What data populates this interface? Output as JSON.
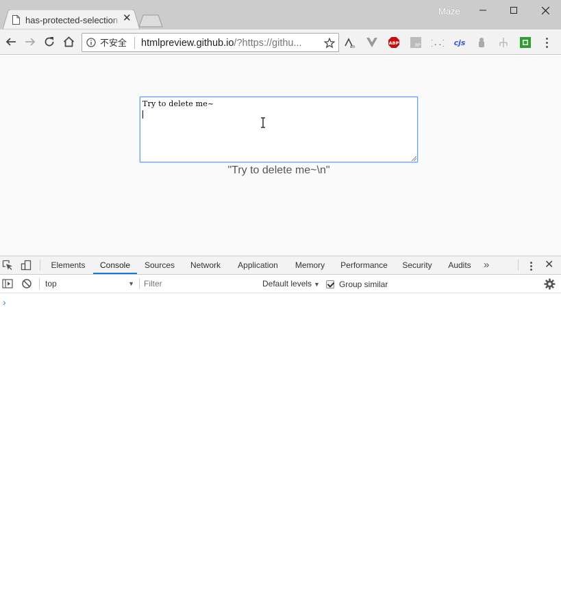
{
  "browser": {
    "tab_title": "has-protected-selection",
    "profile_name": "Maze",
    "security_label": "不安全",
    "url_host": "htmlpreview.github.io",
    "url_rest": "/?https://githu..."
  },
  "page": {
    "textarea_text": "Try to delete me~",
    "output_text": "\"Try to delete me~\\n\""
  },
  "devtools": {
    "tabs": [
      {
        "label": "Elements"
      },
      {
        "label": "Console"
      },
      {
        "label": "Sources"
      },
      {
        "label": "Network"
      },
      {
        "label": "Application"
      },
      {
        "label": "Memory"
      },
      {
        "label": "Performance"
      },
      {
        "label": "Security"
      },
      {
        "label": "Audits"
      }
    ],
    "active_tab": "Console",
    "context": "top",
    "filter_placeholder": "Filter",
    "levels_label": "Default levels",
    "group_similar_label": "Group similar",
    "group_similar_checked": true,
    "prompt_symbol": "›"
  },
  "extensions": [
    "translate-icon",
    "vue-devtools-icon",
    "adblock-plus-icon",
    "rp-icon",
    "json-viewer-icon",
    "cjs-icon",
    "puzzle-extension-icon",
    "tree-extension-icon",
    "green-square-icon"
  ],
  "colors": {
    "accent": "#1a73e8",
    "adblock_red": "#c70d0d",
    "focus_border": "#5b9bff",
    "titlebar_bg": "#cccccc"
  }
}
